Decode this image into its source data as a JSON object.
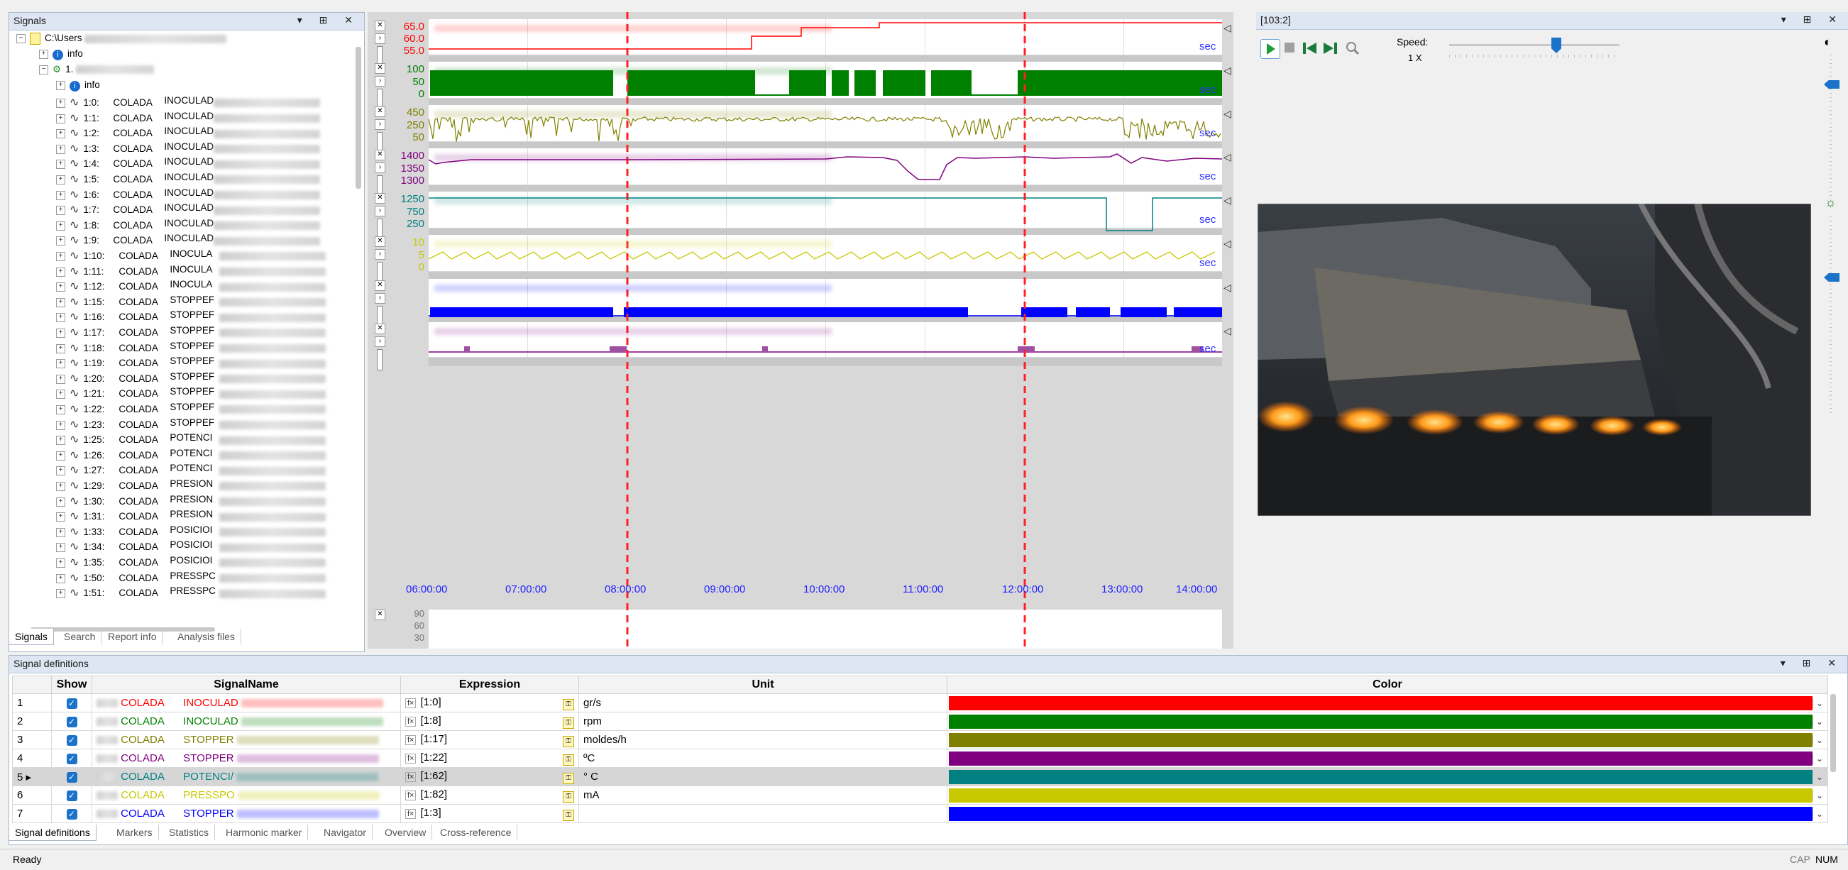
{
  "signals_panel": {
    "title": "Signals",
    "root_label": "C:\\Users",
    "info1": "info",
    "node1": "1.",
    "info2": "info",
    "rows": [
      {
        "id": "1:0:",
        "col": "COLADA",
        "type": "INOCULAD"
      },
      {
        "id": "1:1:",
        "col": "COLADA",
        "type": "INOCULAD"
      },
      {
        "id": "1:2:",
        "col": "COLADA",
        "type": "INOCULAD"
      },
      {
        "id": "1:3:",
        "col": "COLADA",
        "type": "INOCULAD"
      },
      {
        "id": "1:4:",
        "col": "COLADA",
        "type": "INOCULAD"
      },
      {
        "id": "1:5:",
        "col": "COLADA",
        "type": "INOCULAD"
      },
      {
        "id": "1:6:",
        "col": "COLADA",
        "type": "INOCULAD"
      },
      {
        "id": "1:7:",
        "col": "COLADA",
        "type": "INOCULAD"
      },
      {
        "id": "1:8:",
        "col": "COLADA",
        "type": "INOCULAD"
      },
      {
        "id": "1:9:",
        "col": "COLADA",
        "type": "INOCULAD"
      },
      {
        "id": "1:10:",
        "col": "COLADA",
        "type": "INOCULA"
      },
      {
        "id": "1:11:",
        "col": "COLADA",
        "type": "INOCULA"
      },
      {
        "id": "1:12:",
        "col": "COLADA",
        "type": "INOCULA"
      },
      {
        "id": "1:15:",
        "col": "COLADA",
        "type": "STOPPEF"
      },
      {
        "id": "1:16:",
        "col": "COLADA",
        "type": "STOPPEF"
      },
      {
        "id": "1:17:",
        "col": "COLADA",
        "type": "STOPPEF"
      },
      {
        "id": "1:18:",
        "col": "COLADA",
        "type": "STOPPEF"
      },
      {
        "id": "1:19:",
        "col": "COLADA",
        "type": "STOPPEF"
      },
      {
        "id": "1:20:",
        "col": "COLADA",
        "type": "STOPPEF"
      },
      {
        "id": "1:21:",
        "col": "COLADA",
        "type": "STOPPEF"
      },
      {
        "id": "1:22:",
        "col": "COLADA",
        "type": "STOPPEF"
      },
      {
        "id": "1:23:",
        "col": "COLADA",
        "type": "STOPPEF"
      },
      {
        "id": "1:25:",
        "col": "COLADA",
        "type": "POTENCI"
      },
      {
        "id": "1:26:",
        "col": "COLADA",
        "type": "POTENCI"
      },
      {
        "id": "1:27:",
        "col": "COLADA",
        "type": "POTENCI"
      },
      {
        "id": "1:29:",
        "col": "COLADA",
        "type": "PRESION"
      },
      {
        "id": "1:30:",
        "col": "COLADA",
        "type": "PRESION"
      },
      {
        "id": "1:31:",
        "col": "COLADA",
        "type": "PRESION"
      },
      {
        "id": "1:33:",
        "col": "COLADA",
        "type": "POSICIOI"
      },
      {
        "id": "1:34:",
        "col": "COLADA",
        "type": "POSICIOI"
      },
      {
        "id": "1:35:",
        "col": "COLADA",
        "type": "POSICIOI"
      },
      {
        "id": "1:50:",
        "col": "COLADA",
        "type": "PRESSPC"
      },
      {
        "id": "1:51:",
        "col": "COLADA",
        "type": "PRESSPC"
      }
    ],
    "tabs": [
      "Signals",
      "Search",
      "Report info",
      "Analysis files"
    ]
  },
  "charts": {
    "x_ticks": [
      "06:00:00",
      "07:00:00",
      "08:00:00",
      "09:00:00",
      "10:00:00",
      "11:00:00",
      "12:00:00",
      "13:00:00",
      "14:00:00"
    ],
    "unit_label": "sec",
    "plots": [
      {
        "color": "#ff0000",
        "ticks": [
          "65.0",
          "60.0",
          "55.0"
        ],
        "show_sec": true
      },
      {
        "color": "#008000",
        "ticks": [
          "100",
          "50",
          "0"
        ],
        "show_sec": true
      },
      {
        "color": "#808000",
        "ticks": [
          "450",
          "250",
          "50"
        ],
        "show_sec": true
      },
      {
        "color": "#800080",
        "ticks": [
          "1400",
          "1350",
          "1300"
        ],
        "show_sec": true
      },
      {
        "color": "#008080",
        "ticks": [
          "1250",
          "750",
          "250"
        ],
        "show_sec": true
      },
      {
        "color": "#c8c800",
        "ticks": [
          "10",
          "5",
          "0"
        ],
        "show_sec": true
      },
      {
        "color": "#0000ff",
        "ticks": [],
        "show_sec": false
      },
      {
        "color": "#800080",
        "ticks": [],
        "show_sec": true
      }
    ],
    "extra_ticks": [
      "90",
      "60",
      "30"
    ]
  },
  "video_panel": {
    "title": "[103:2]",
    "speed_label": "Speed:",
    "speed_value": "1 X"
  },
  "defs_panel": {
    "title": "Signal definitions",
    "headers": {
      "show": "Show",
      "signal_name": "SignalName",
      "expression": "Expression",
      "unit": "Unit",
      "color": "Color"
    },
    "rows": [
      {
        "num": "1",
        "col": "COLADA",
        "name": "INOCULAD",
        "expr": "[1:0]",
        "unit": "gr/s",
        "color": "#ff0000",
        "selected": false
      },
      {
        "num": "2",
        "col": "COLADA",
        "name": "INOCULAD",
        "expr": "[1:8]",
        "unit": "rpm",
        "color": "#008000",
        "selected": false
      },
      {
        "num": "3",
        "col": "COLADA",
        "name": "STOPPER",
        "expr": "[1:17]",
        "unit": "moldes/h",
        "color": "#808000",
        "selected": false
      },
      {
        "num": "4",
        "col": "COLADA",
        "name": "STOPPER",
        "expr": "[1:22]",
        "unit": "ºC",
        "color": "#800080",
        "selected": false
      },
      {
        "num": "5",
        "col": "COLADA",
        "name": "POTENCI/",
        "expr": "[1:62]",
        "unit": "° C",
        "color": "#008080",
        "selected": true
      },
      {
        "num": "6",
        "col": "COLADA",
        "name": "PRESSPO",
        "expr": "[1:82]",
        "unit": "mA",
        "color": "#c8c800",
        "selected": false
      },
      {
        "num": "7",
        "col": "COLADA",
        "name": "STOPPER",
        "expr": "[1:3]",
        "unit": "",
        "color": "#0000ff",
        "selected": false
      }
    ],
    "tabs": [
      "Signal definitions",
      "Markers",
      "Statistics",
      "Harmonic marker",
      "Navigator",
      "Overview",
      "Cross-reference"
    ]
  },
  "status": {
    "text": "Ready",
    "cap": "CAP",
    "num": "NUM"
  },
  "icons": {
    "play": "play-icon",
    "stop": "stop-icon",
    "prev": "skip-back-icon",
    "next": "skip-forward-icon",
    "zoom": "zoom-icon"
  }
}
